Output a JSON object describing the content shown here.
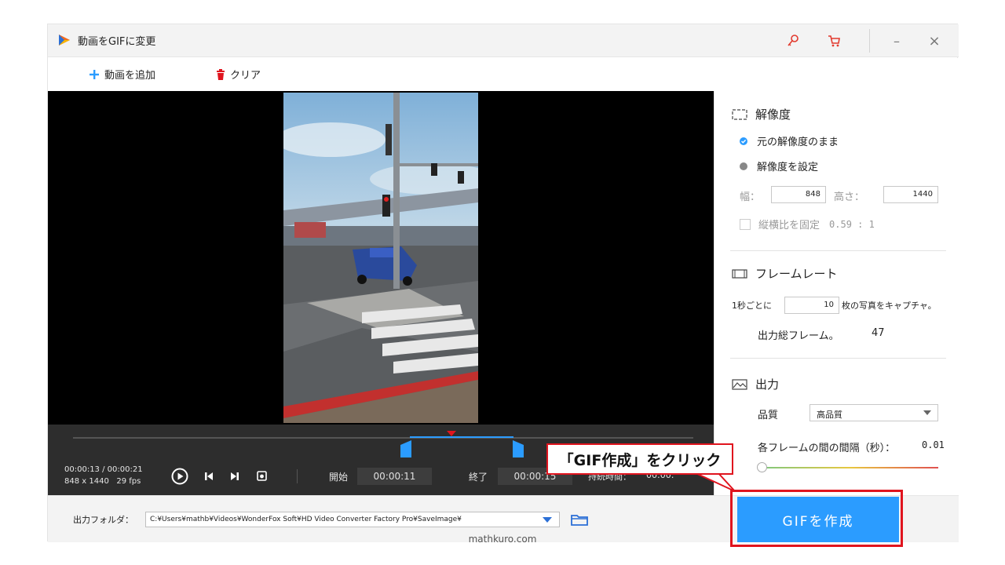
{
  "window": {
    "title": "動画をGIFに変更",
    "minimize_glyph": "–",
    "close_glyph": "×"
  },
  "toolbar": {
    "add_label": "動画を追加",
    "clear_label": "クリア"
  },
  "controls": {
    "time_readout": "00:00:13 / 00:00:21",
    "media_info": "848 x 1440   29 fps",
    "start_label": "開始",
    "start_value": "00:00:11",
    "end_label": "終了",
    "end_value": "00:00:15",
    "duration_label": "持続時間：",
    "duration_value": "00:00:"
  },
  "panel": {
    "resolution": {
      "title": "解像度",
      "option_original": "元の解像度のまま",
      "option_custom": "解像度を設定",
      "width_label": "幅：",
      "width_value": "848",
      "height_label": "高さ：",
      "height_value": "1440",
      "lock_label": "縦横比を固定",
      "ratio": "0.59 : 1"
    },
    "framerate": {
      "title": "フレームレート",
      "prefix": "1秒ごとに",
      "value": "10",
      "suffix": "枚の写真をキャプチャ。",
      "total_label": "出力総フレーム。",
      "total_value": "47"
    },
    "output": {
      "title": "出力",
      "quality_label": "品質",
      "quality_value": "高品質",
      "interval_label": "各フレームの間の間隔（秒）：",
      "interval_value": "0.01"
    }
  },
  "bottom": {
    "folder_label": "出力フォルダ：",
    "folder_path": "C:¥Users¥mathb¥Videos¥WonderFox Soft¥HD Video Converter Factory Pro¥SaveImage¥"
  },
  "create_button": "GIFを作成",
  "annotation": "「GIF作成」をクリック",
  "credit": "mathkuro.com",
  "colors": {
    "accent": "#2b9cff",
    "annotation_red": "#e0141e",
    "video_bg": "#000000",
    "controls_bg": "#2d2d2d"
  },
  "icons": [
    "app-logo-icon",
    "key-icon",
    "cart-icon",
    "plus-icon",
    "trash-icon",
    "play-icon",
    "prev-icon",
    "next-icon",
    "snapshot-icon",
    "folder-icon",
    "resolution-icon",
    "framerate-icon",
    "output-icon",
    "dropdown-arrow-icon",
    "check-icon"
  ]
}
